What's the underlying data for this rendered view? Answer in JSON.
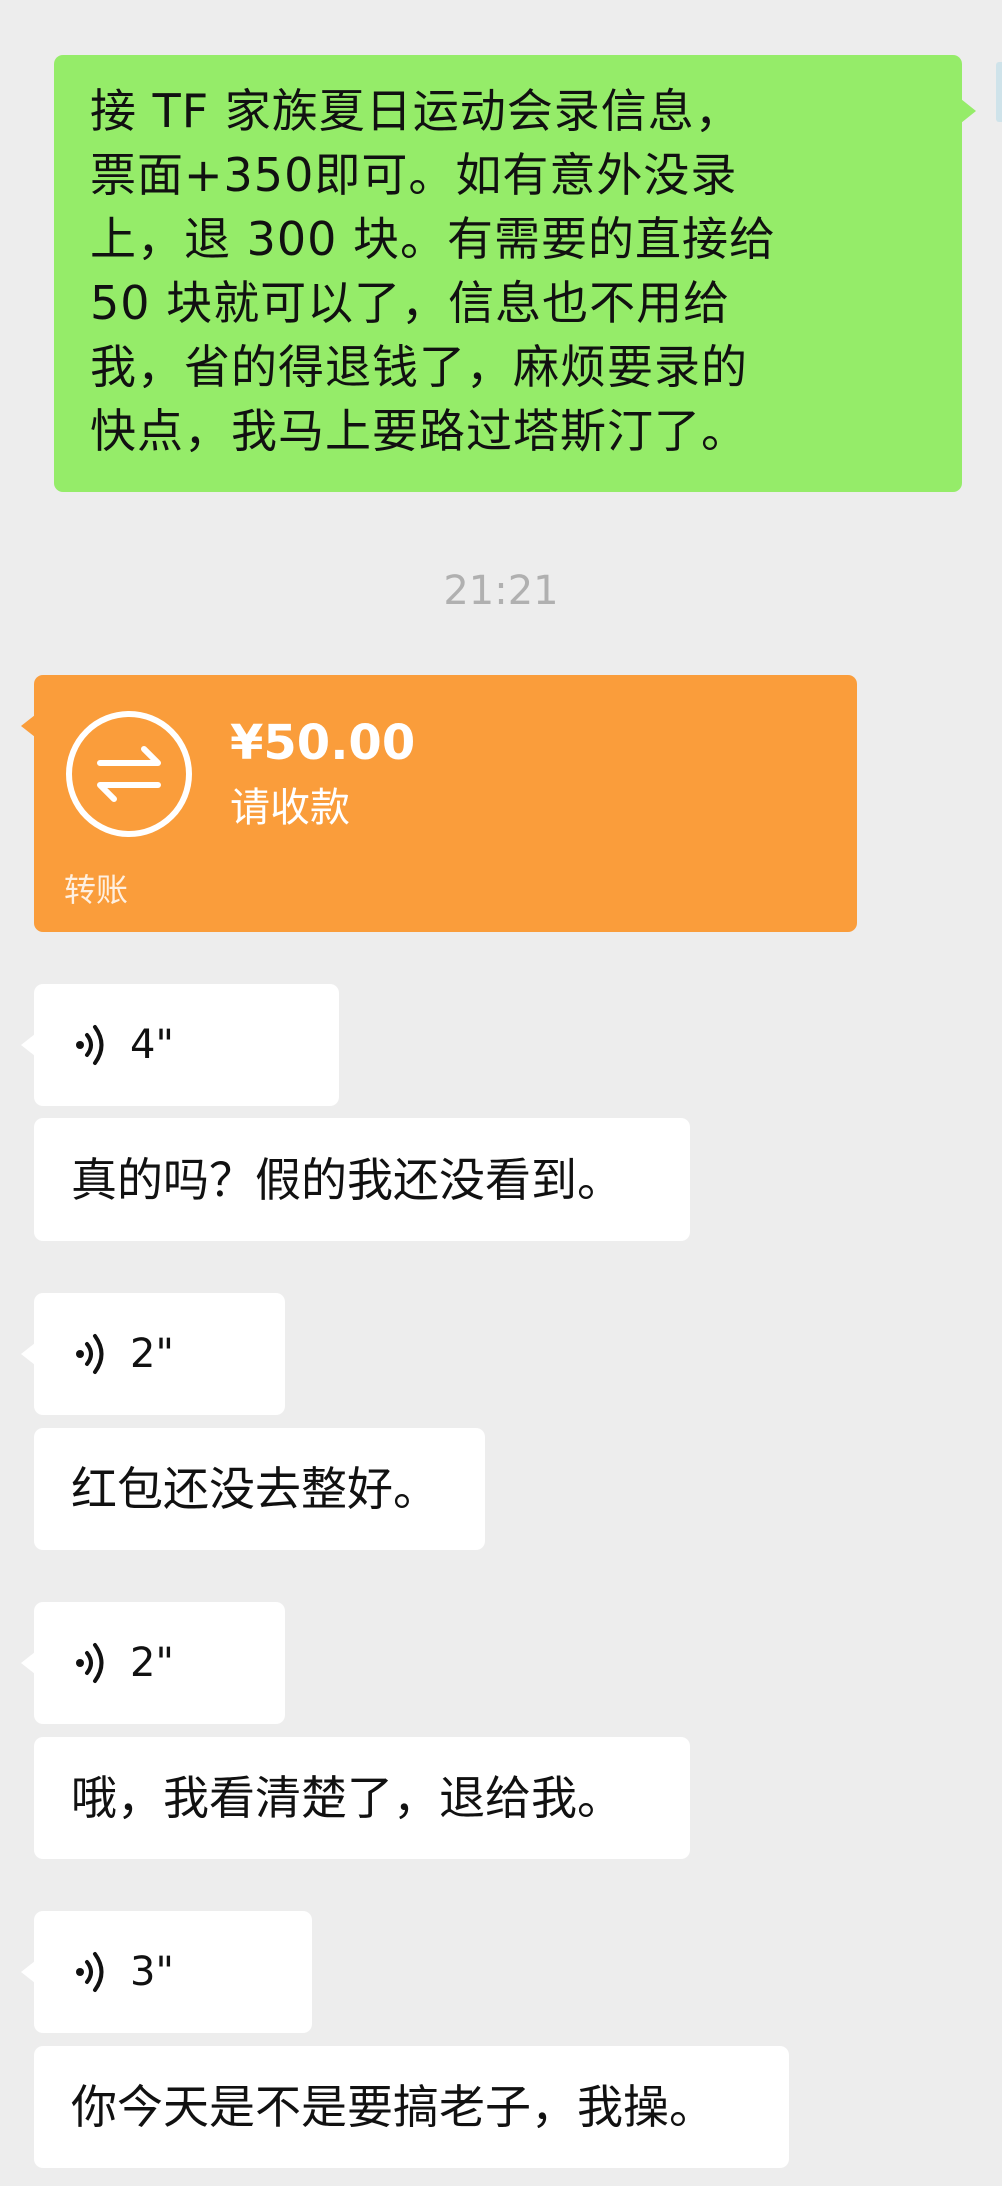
{
  "sent_message": {
    "text": "接 TF 家族夏日运动会录信息，票面+350即可。如有意外没录上，退 300 块。有需要的直接给 50 块就可以了，信息也不用给我，省的得退钱了，麻烦要录的快点，我马上要路过塔斯汀了。"
  },
  "timestamp": "21:21",
  "transfer": {
    "amount": "¥50.00",
    "status": "请收款",
    "label": "转账",
    "icon": "transfer-arrows-icon"
  },
  "voice_icon": "voice-waves-icon",
  "messages": [
    {
      "voice_duration": "4\"",
      "text": "真的吗？假的我还没看到。"
    },
    {
      "voice_duration": "2\"",
      "text": "红包还没去整好。"
    },
    {
      "voice_duration": "2\"",
      "text": "哦，我看清楚了，退给我。"
    },
    {
      "voice_duration": "3\"",
      "text": "你今天是不是要搞老子，我操。"
    }
  ],
  "colors": {
    "background": "#ededed",
    "sent_bubble": "#95ec69",
    "received_bubble": "#ffffff",
    "transfer_card": "#fa9d3b",
    "timestamp": "#b0b0b0"
  }
}
